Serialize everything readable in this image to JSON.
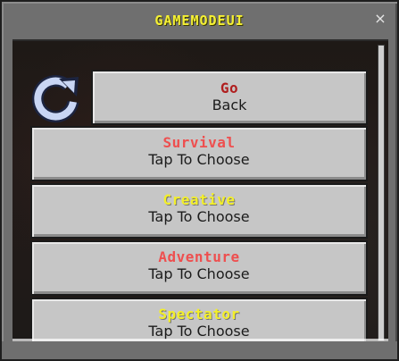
{
  "window": {
    "title": "GAMEMODEUI",
    "close_glyph": "×"
  },
  "refresh": {
    "icon": "refresh-icon",
    "color": "#c9d6f4"
  },
  "buttons": [
    {
      "id": "go-back",
      "label": "Go",
      "sub": "Back",
      "color": "#b01e1e"
    },
    {
      "id": "survival",
      "label": "Survival",
      "sub": "Tap To Choose",
      "color": "#ee4f4f"
    },
    {
      "id": "creative",
      "label": "Creative",
      "sub": "Tap To Choose",
      "color": "#f3ef2a"
    },
    {
      "id": "adventure",
      "label": "Adventure",
      "sub": "Tap To Choose",
      "color": "#ee4f4f"
    },
    {
      "id": "spectator",
      "label": "Spectator",
      "sub": "Tap To Choose",
      "color": "#f3ef2a"
    }
  ]
}
